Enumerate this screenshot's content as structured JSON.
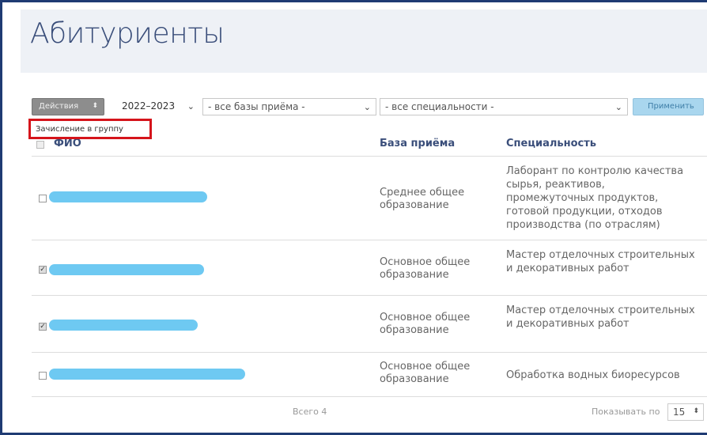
{
  "page": {
    "title": "Абитуриенты"
  },
  "toolbar": {
    "actions_label": "Действия",
    "actions_arrows": "⬍",
    "year_value": "2022–2023",
    "year_chevron": "⌄",
    "bases_value": "- все базы приёма -",
    "specs_value": "- все специальности -",
    "select_chevron": "⌄",
    "apply_label": "Применить"
  },
  "actions_menu": {
    "item": "Зачисление в группу"
  },
  "table": {
    "headers": {
      "fio": "ФИО",
      "base": "База приёма",
      "spec": "Специальность"
    },
    "rows": [
      {
        "checked": "",
        "base": "Среднее общее образование",
        "spec": "Лаборант по контролю качества сырья, реактивов, промежуточных продуктов, готовой продукции, отходов производства (по отраслям)"
      },
      {
        "checked": "✓",
        "base": "Основное общее образование",
        "spec": "Мастер отделочных строительных и декоративных работ"
      },
      {
        "checked": "✓",
        "base": "Основное общее образование",
        "spec": "Мастер отделочных строительных и декоративных работ"
      },
      {
        "checked": "",
        "base": "Основное общее образование",
        "spec": "Обработка водных биоресурсов"
      }
    ]
  },
  "footer": {
    "total": "Всего 4",
    "perpage_label": "Показывать по",
    "perpage_value": "15",
    "perpage_arrows": "⬍"
  },
  "colors": {
    "title": "#3a4e7a",
    "highlight": "#d5141b",
    "redaction": "#5ec3f1",
    "apply": "#a9d6ee"
  }
}
